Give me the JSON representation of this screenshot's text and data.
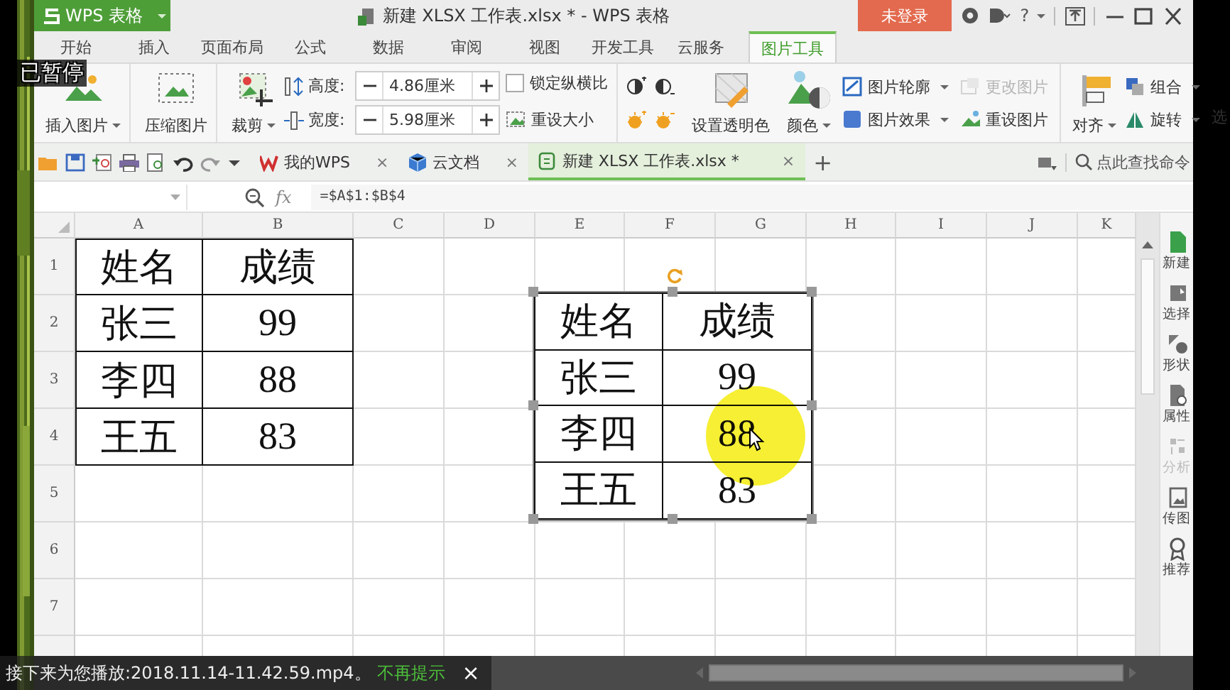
{
  "title_bar": {
    "app_button": "WPS 表格",
    "title": "新建 XLSX 工作表.xlsx * - WPS 表格",
    "login": "未登录",
    "help": "?"
  },
  "menu_tabs": [
    {
      "label": "开始",
      "selected": false
    },
    {
      "label": "插入",
      "selected": false
    },
    {
      "label": "页面布局",
      "selected": false
    },
    {
      "label": "公式",
      "selected": false
    },
    {
      "label": "数据",
      "selected": false
    },
    {
      "label": "审阅",
      "selected": false
    },
    {
      "label": "视图",
      "selected": false
    },
    {
      "label": "开发工具",
      "selected": false
    },
    {
      "label": "云服务",
      "selected": false
    },
    {
      "label": "图片工具",
      "selected": true
    }
  ],
  "ribbon": [
    {
      "kind": "large",
      "label": "插入图片",
      "dropdown": true
    },
    {
      "kind": "large",
      "label": "压缩图片",
      "dropdown": false
    },
    {
      "kind": "large",
      "label": "裁剪",
      "dropdown": true
    },
    {
      "kind": "size",
      "rows": [
        {
          "label": "高度:",
          "value": "4.86厘米"
        },
        {
          "label": "宽度:",
          "value": "5.98厘米"
        }
      ]
    },
    {
      "kind": "stack",
      "rows": [
        {
          "kind": "checkbox",
          "label": "锁定纵横比",
          "checked": false,
          "disabled": false
        },
        {
          "kind": "button",
          "label": "重设大小",
          "disabled": false,
          "dropdown": false
        }
      ]
    },
    {
      "kind": "adjust"
    },
    {
      "kind": "large",
      "label": "设置透明色",
      "dropdown": false
    },
    {
      "kind": "large",
      "label": "颜色",
      "dropdown": true
    },
    {
      "kind": "stack",
      "rows": [
        {
          "kind": "button",
          "label": "图片轮廓",
          "disabled": false,
          "dropdown": true
        },
        {
          "kind": "button",
          "label": "图片效果",
          "disabled": false,
          "dropdown": true
        }
      ]
    },
    {
      "kind": "stack",
      "rows": [
        {
          "kind": "button",
          "label": "更改图片",
          "disabled": true,
          "dropdown": false
        },
        {
          "kind": "button",
          "label": "重设图片",
          "disabled": false,
          "dropdown": false
        }
      ]
    },
    {
      "kind": "large",
      "label": "对齐",
      "dropdown": true
    },
    {
      "kind": "stack",
      "rows": [
        {
          "kind": "button",
          "label": "组合",
          "disabled": false,
          "dropdown": true
        },
        {
          "kind": "button",
          "label": "旋转",
          "disabled": false,
          "dropdown": true
        }
      ]
    },
    {
      "kind": "cut",
      "label": "选"
    }
  ],
  "doc_tabs": [
    {
      "label": "我的WPS",
      "selected": false,
      "close": "×"
    },
    {
      "label": "云文档",
      "selected": false,
      "close": "×"
    },
    {
      "label": "新建 XLSX 工作表.xlsx *",
      "selected": true,
      "close": "×"
    }
  ],
  "new_tab": "+",
  "command_search": {
    "placeholder": "点此查找命令"
  },
  "formula_bar": {
    "fx": "fx",
    "formula": "=$A$1:$B$4"
  },
  "sheet": {
    "columns": [
      "A",
      "B",
      "C",
      "D",
      "E",
      "F",
      "G",
      "H",
      "I",
      "J",
      "K"
    ],
    "rows": [
      "1",
      "2",
      "3",
      "4",
      "5",
      "6",
      "7"
    ],
    "table": {
      "bordered": true,
      "cells": [
        [
          "姓名",
          "成绩"
        ],
        [
          "张三",
          "99"
        ],
        [
          "李四",
          "88"
        ],
        [
          "王五",
          "83"
        ]
      ]
    }
  },
  "picture_object": {
    "selected": true,
    "cells": [
      [
        "姓名",
        "成绩"
      ],
      [
        "张三",
        "99"
      ],
      [
        "李四",
        "88"
      ],
      [
        "王五",
        "83"
      ]
    ]
  },
  "sidebar": [
    {
      "label": "新建",
      "disabled": false
    },
    {
      "label": "选择",
      "disabled": false
    },
    {
      "label": "形状",
      "disabled": false
    },
    {
      "label": "属性",
      "disabled": false
    },
    {
      "label": "分析",
      "disabled": true
    },
    {
      "label": "传图",
      "disabled": false
    },
    {
      "label": "推荐",
      "disabled": false
    }
  ],
  "player": {
    "paused": "已暂停",
    "next_up": "接下来为您播放:2018.11.14-11.42.59.mp4。",
    "dismiss": "不再提示",
    "close": "×"
  }
}
